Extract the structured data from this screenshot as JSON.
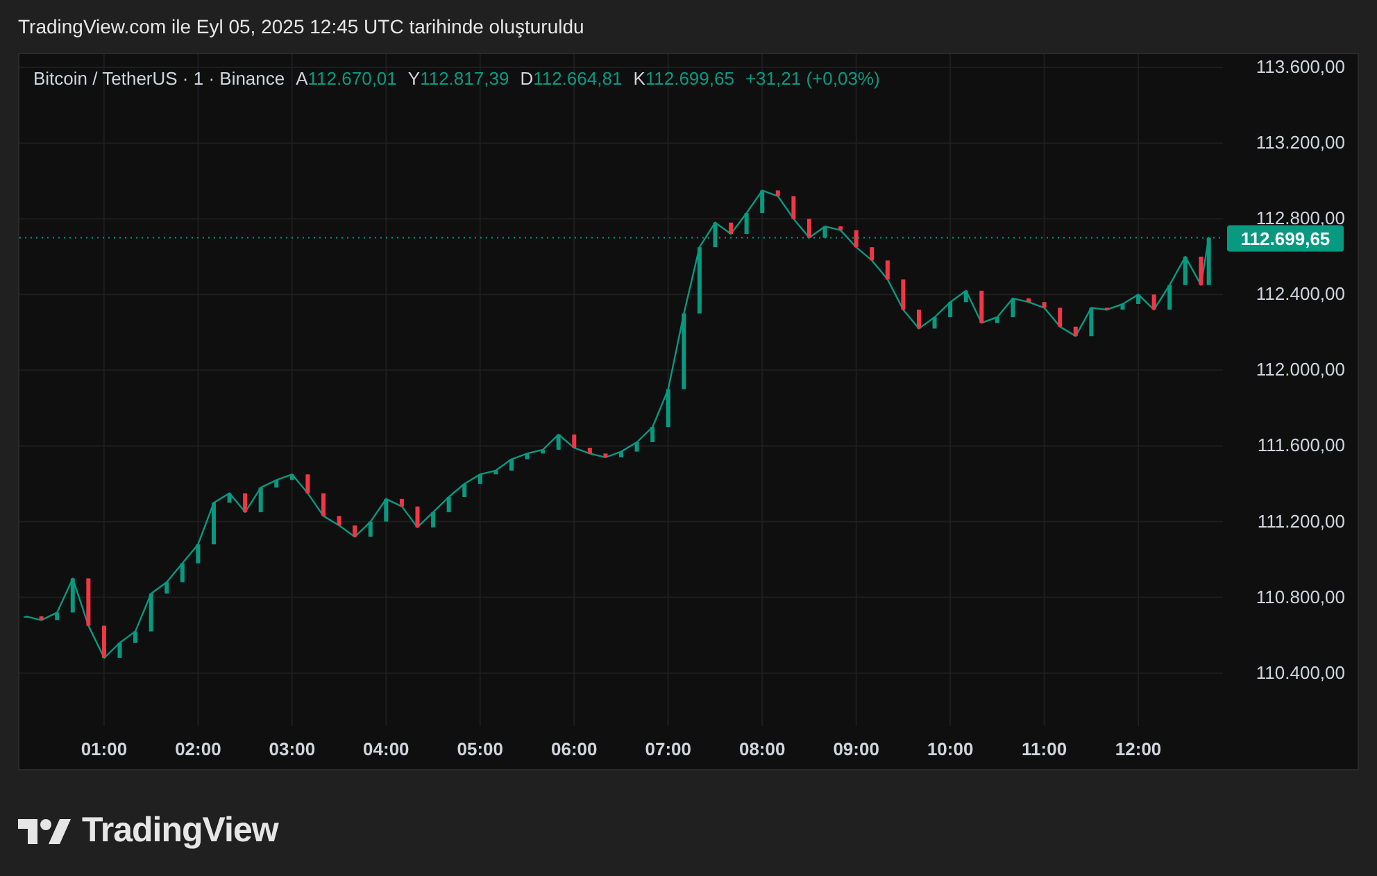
{
  "caption": "TradingView.com ile Eyl 05, 2025 12:45 UTC tarihinde oluşturuldu",
  "legend": {
    "symbol": "Bitcoin / TetherUS · 1 · Binance",
    "ohlc": [
      {
        "label": "A",
        "value": "112.670,01"
      },
      {
        "label": "Y",
        "value": "112.817,39"
      },
      {
        "label": "D",
        "value": "112.664,81"
      },
      {
        "label": "K",
        "value": "112.699,65"
      }
    ],
    "change": "+31,21 (+0,03%)"
  },
  "last_price": "112.699,65",
  "chart_data": {
    "type": "line",
    "grid": true,
    "x": [
      10,
      20,
      30,
      40,
      50,
      60,
      70,
      80,
      90,
      100,
      110,
      120,
      130,
      140,
      150,
      160,
      170,
      180,
      190,
      200,
      210,
      220,
      230,
      240,
      250,
      260,
      270,
      280,
      290,
      300,
      310,
      320,
      330,
      340,
      350,
      360,
      370,
      380,
      390,
      400,
      410,
      420,
      430,
      440,
      450,
      460,
      470,
      480,
      490,
      500,
      510,
      520,
      530,
      540,
      550,
      560,
      570,
      580,
      590,
      600,
      610,
      620,
      630,
      640,
      650,
      660,
      670,
      680,
      690,
      700,
      710,
      720,
      730,
      740,
      750,
      760,
      765
    ],
    "series": [
      {
        "color": "#089981",
        "values": [
          110700,
          110680,
          110720,
          110900,
          110650,
          110480,
          110560,
          110620,
          110820,
          110880,
          110980,
          111080,
          111300,
          111350,
          111250,
          111380,
          111420,
          111450,
          111350,
          111230,
          111180,
          111120,
          111200,
          111320,
          111280,
          111170,
          111250,
          111330,
          111400,
          111450,
          111470,
          111530,
          111560,
          111580,
          111660,
          111590,
          111560,
          111540,
          111570,
          111620,
          111700,
          111900,
          112300,
          112650,
          112780,
          112720,
          112830,
          112950,
          112920,
          112800,
          112700,
          112760,
          112740,
          112650,
          112580,
          112480,
          112320,
          112220,
          112280,
          112360,
          112420,
          112250,
          112280,
          112380,
          112360,
          112330,
          112230,
          112180,
          112330,
          112320,
          112350,
          112400,
          112320,
          112450,
          112600,
          112450,
          112700
        ]
      }
    ],
    "xlim": [
      6,
      774
    ],
    "ylim": [
      110120,
      113670
    ],
    "yticks": [
      {
        "value": 113600,
        "label": "113.600,00"
      },
      {
        "value": 113200,
        "label": "113.200,00"
      },
      {
        "value": 112800,
        "label": "112.800,00"
      },
      {
        "value": 112400,
        "label": "112.400,00"
      },
      {
        "value": 112000,
        "label": "112.000,00"
      },
      {
        "value": 111600,
        "label": "111.600,00"
      },
      {
        "value": 111200,
        "label": "111.200,00"
      },
      {
        "value": 110800,
        "label": "110.800,00"
      },
      {
        "value": 110400,
        "label": "110.400,00"
      }
    ],
    "xticks": [
      {
        "value": 60,
        "label": "01:00"
      },
      {
        "value": 120,
        "label": "02:00"
      },
      {
        "value": 180,
        "label": "03:00"
      },
      {
        "value": 240,
        "label": "04:00"
      },
      {
        "value": 300,
        "label": "05:00"
      },
      {
        "value": 360,
        "label": "06:00"
      },
      {
        "value": 420,
        "label": "07:00"
      },
      {
        "value": 480,
        "label": "08:00"
      },
      {
        "value": 540,
        "label": "09:00"
      },
      {
        "value": 600,
        "label": "10:00"
      },
      {
        "value": 660,
        "label": "11:00"
      },
      {
        "value": 720,
        "label": "12:00"
      }
    ]
  },
  "brand": "TradingView"
}
